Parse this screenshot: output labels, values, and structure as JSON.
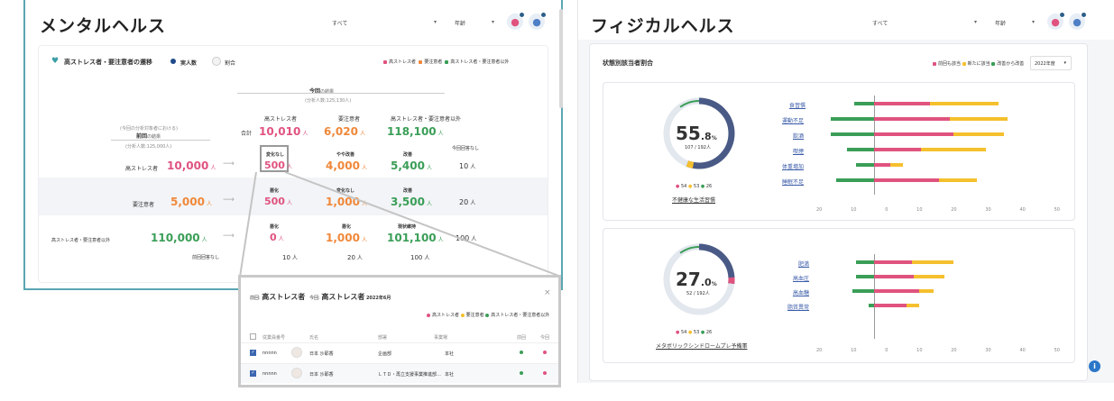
{
  "mental": {
    "title": "メンタルヘルス",
    "filter1": "すべて",
    "filter2": "年齢",
    "card_title": "高ストレス者・要注意者の遷移",
    "toggle_count": "実人数",
    "toggle_ratio": "割合",
    "legend": [
      "高ストレス者",
      "要注意者",
      "高ストレス者・要注意者以外"
    ],
    "current_label": "今回",
    "current_sub": "の結果",
    "current_count": "(分析人数:125,130人)",
    "prev_note": "(今回の分析対象者における)",
    "prev_label": "前回",
    "prev_sub": "の結果",
    "prev_count": "(分析人数:125,000人)",
    "col_headers": [
      "高ストレス者",
      "要注意者",
      "高ストレス者・要注意者以外"
    ],
    "total_label": "合計",
    "totals": [
      "10,010",
      "6,020",
      "118,100"
    ],
    "no_current_label": "今回回答なし",
    "no_prev_label": "前回回答なし",
    "unit": "人",
    "rows": [
      {
        "label": "高ストレス者",
        "value": "10,000",
        "cells": [
          {
            "tag": "変化なし",
            "v": "500"
          },
          {
            "tag": "やや改善",
            "v": "4,000"
          },
          {
            "tag": "改善",
            "v": "5,400"
          }
        ],
        "none": "10"
      },
      {
        "label": "要注意者",
        "value": "5,000",
        "cells": [
          {
            "tag": "悪化",
            "v": "500"
          },
          {
            "tag": "変化なし",
            "v": "1,000"
          },
          {
            "tag": "改善",
            "v": "3,500"
          }
        ],
        "none": "20"
      },
      {
        "label": "高ストレス者・要注意者以外",
        "value": "110,000",
        "cells": [
          {
            "tag": "悪化",
            "v": "0"
          },
          {
            "tag": "悪化",
            "v": "1,000"
          },
          {
            "tag": "現状維持",
            "v": "101,100"
          }
        ],
        "none": "100"
      }
    ],
    "no_prev_values": [
      "10",
      "20",
      "100"
    ]
  },
  "popup": {
    "prev_prefix": "前回:",
    "prev_value": "高ストレス者",
    "cur_prefix": "今回:",
    "cur_value": "高ストレス者",
    "period": "2022年6月",
    "close": "×",
    "legend": [
      "高ストレス者",
      "要注意者",
      "高ストレス者・要注意者以外"
    ],
    "headers": [
      "従業員番号",
      "氏名",
      "部署",
      "事業場",
      "前回",
      "今回"
    ],
    "rows": [
      {
        "id": "nnnnn",
        "name": "日本 沙耶香",
        "dept": "企画部",
        "site": "本社"
      },
      {
        "id": "nnnnn",
        "name": "日本 沙耶香",
        "dept": "ＬＴＤ・再立支援事業推進部…",
        "site": "本社"
      }
    ]
  },
  "physical": {
    "title": "フィジカルヘルス",
    "filter1": "すべて",
    "filter2": "年齢",
    "card_title": "状態別該当者割合",
    "legend": [
      "前回も該当",
      "新たに該当",
      "改善から改善"
    ],
    "year": "2022年度",
    "panels": [
      {
        "percent": "55",
        "decimal": ".8",
        "pct_sign": "%",
        "ratio": "107 / 192人",
        "mini_legend": [
          "54",
          "53",
          "26"
        ],
        "caption": "不健康な生活習慣",
        "categories": [
          "食習慣",
          "運動不足",
          "飲酒",
          "喫煙",
          "体重増加",
          "睡眠不足"
        ],
        "axis": [
          "20",
          "10",
          "0",
          "10",
          "20",
          "30",
          "40",
          "50"
        ]
      },
      {
        "percent": "27",
        "decimal": ".0",
        "pct_sign": "%",
        "ratio": "52 / 192人",
        "mini_legend": [
          "54",
          "53",
          "26"
        ],
        "caption": "メタボリックシンドロームプレ予備軍",
        "categories": [
          "肥満",
          "高血圧",
          "高血糖",
          "脂質異常"
        ],
        "axis": [
          "20",
          "10",
          "0",
          "10",
          "20",
          "30",
          "40",
          "50"
        ]
      }
    ]
  },
  "colors": {
    "pink": "#e0537f",
    "orange": "#f0883a",
    "yellow": "#f5c02d",
    "green": "#3a9e57",
    "navy": "#4a5a86",
    "info": "#2b77c8"
  }
}
